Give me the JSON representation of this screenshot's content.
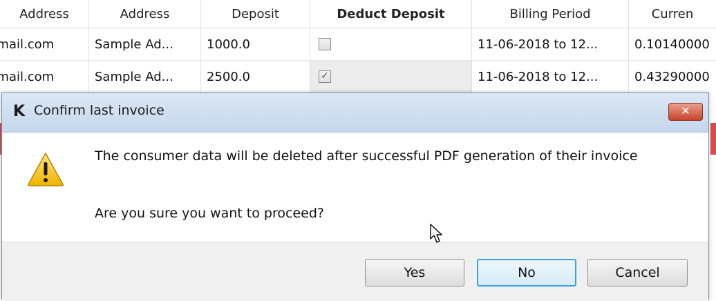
{
  "table": {
    "headers": [
      "Address",
      "Address",
      "Deposit",
      "Deduct Deposit",
      "Billing Period",
      "Curren"
    ],
    "rows": [
      {
        "email": "gmail.com",
        "address": "Sample Ad...",
        "deposit": "1000.0",
        "deduct_checked": false,
        "billing_period": "11-06-2018 to 12...",
        "current": "0.10140000"
      },
      {
        "email": "gmail.com",
        "address": "Sample Ad...",
        "deposit": "2500.0",
        "deduct_checked": true,
        "billing_period": "11-06-2018 to 12...",
        "current": "0.43290000"
      }
    ]
  },
  "dialog": {
    "app_icon_letter": "K",
    "title": "Confirm last invoice",
    "close_glyph": "✕",
    "message": "The consumer data will be deleted after successful PDF generation of their invoice",
    "question": "Are you sure you want to proceed?",
    "icon": "warning-icon",
    "buttons": {
      "yes": "Yes",
      "no": "No",
      "cancel": "Cancel"
    },
    "default_button": "No"
  },
  "colors": {
    "title_gradient_top": "#dbe7f5",
    "close_button": "#c8432b",
    "default_button_border": "#3c9fe0",
    "warning_fill": "#f5c518"
  }
}
